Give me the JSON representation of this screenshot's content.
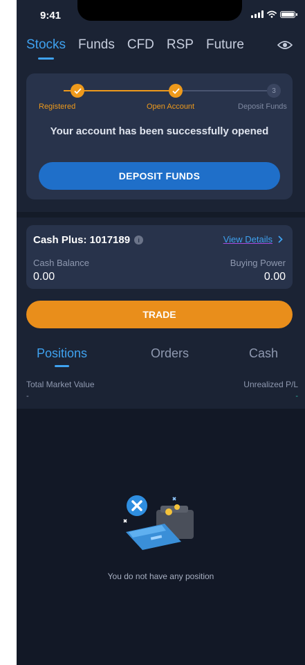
{
  "status_bar": {
    "time": "9:41"
  },
  "market_tabs": [
    {
      "label": "Stocks",
      "active": true
    },
    {
      "label": "Funds",
      "active": false
    },
    {
      "label": "CFD",
      "active": false
    },
    {
      "label": "RSP",
      "active": false
    },
    {
      "label": "Future",
      "active": false
    }
  ],
  "onboarding": {
    "steps": [
      {
        "label": "Registered",
        "state": "done"
      },
      {
        "label": "Open Account",
        "state": "done"
      },
      {
        "label": "Deposit Funds",
        "state": "pending",
        "number": "3"
      }
    ],
    "message": "Your account has been successfully opened",
    "deposit_button": "DEPOSIT FUNDS"
  },
  "account": {
    "title": "Cash Plus: 1017189",
    "view_details": "View Details",
    "cash_balance_label": "Cash Balance",
    "cash_balance_value": "0.00",
    "buying_power_label": "Buying Power",
    "buying_power_value": "0.00"
  },
  "trade_button": "TRADE",
  "position_tabs": [
    {
      "label": "Positions",
      "active": true
    },
    {
      "label": "Orders",
      "active": false
    },
    {
      "label": "Cash",
      "active": false
    }
  ],
  "summary": {
    "total_market_value_label": "Total Market Value",
    "total_market_value": "-",
    "unrealized_pl_label": "Unrealized P/L",
    "unrealized_pl": "-"
  },
  "empty_state": {
    "message": "You do not have any position"
  },
  "colors": {
    "accent_blue": "#3fa2f0",
    "step_orange": "#ee9a1c",
    "trade_orange": "#e98e1b",
    "deposit_blue": "#1f6fc9",
    "background": "#1b2334",
    "card": "#28334b"
  },
  "icons": [
    "signal-icon",
    "wifi-icon",
    "battery-icon",
    "eye-icon",
    "check-icon",
    "info-icon",
    "chevron-right-icon",
    "empty-wallet-icon"
  ]
}
